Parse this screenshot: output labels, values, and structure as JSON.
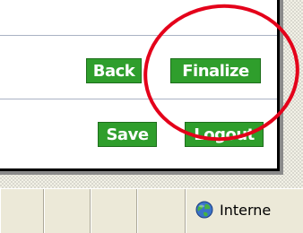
{
  "actions": {
    "back_label": "Back",
    "finalize_label": "Finalize",
    "save_label": "Save",
    "logout_label": "Logout"
  },
  "status_bar": {
    "zone_label": "Interne",
    "zone_icon": "globe-icon"
  },
  "colors": {
    "button_green": "#2f9e2c",
    "highlight_red": "#e4001a",
    "status_bar_bg": "#ece9d8"
  }
}
